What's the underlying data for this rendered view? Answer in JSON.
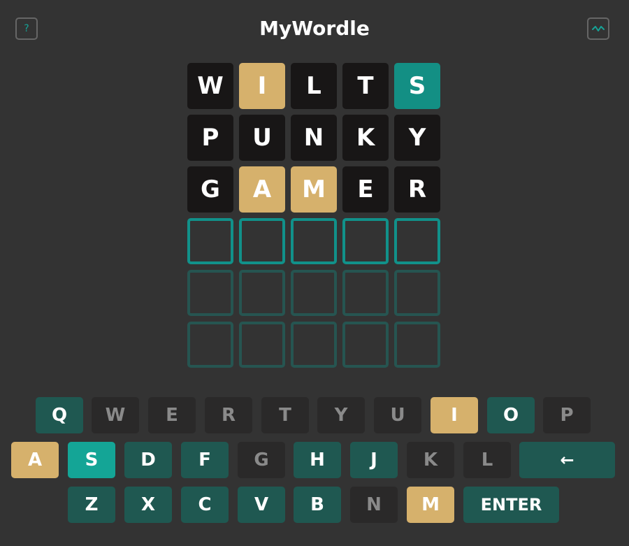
{
  "header": {
    "title": "MyWordle",
    "help_icon": "?",
    "stats_icon": "⌇"
  },
  "board": [
    [
      {
        "letter": "W",
        "state": "absent"
      },
      {
        "letter": "I",
        "state": "present"
      },
      {
        "letter": "L",
        "state": "absent"
      },
      {
        "letter": "T",
        "state": "absent"
      },
      {
        "letter": "S",
        "state": "correct"
      }
    ],
    [
      {
        "letter": "P",
        "state": "absent"
      },
      {
        "letter": "U",
        "state": "absent"
      },
      {
        "letter": "N",
        "state": "absent"
      },
      {
        "letter": "K",
        "state": "absent"
      },
      {
        "letter": "Y",
        "state": "absent"
      }
    ],
    [
      {
        "letter": "G",
        "state": "absent"
      },
      {
        "letter": "A",
        "state": "present"
      },
      {
        "letter": "M",
        "state": "present"
      },
      {
        "letter": "E",
        "state": "absent"
      },
      {
        "letter": "R",
        "state": "absent"
      }
    ],
    [
      {
        "letter": "",
        "state": "empty-active"
      },
      {
        "letter": "",
        "state": "empty-active"
      },
      {
        "letter": "",
        "state": "empty-active"
      },
      {
        "letter": "",
        "state": "empty-active"
      },
      {
        "letter": "",
        "state": "empty-active"
      }
    ],
    [
      {
        "letter": "",
        "state": "empty"
      },
      {
        "letter": "",
        "state": "empty"
      },
      {
        "letter": "",
        "state": "empty"
      },
      {
        "letter": "",
        "state": "empty"
      },
      {
        "letter": "",
        "state": "empty"
      }
    ],
    [
      {
        "letter": "",
        "state": "empty"
      },
      {
        "letter": "",
        "state": "empty"
      },
      {
        "letter": "",
        "state": "empty"
      },
      {
        "letter": "",
        "state": "empty"
      },
      {
        "letter": "",
        "state": "empty"
      }
    ]
  ],
  "keyboard": {
    "row1": [
      {
        "label": "Q",
        "state": "tried"
      },
      {
        "label": "W",
        "state": "unused"
      },
      {
        "label": "E",
        "state": "unused"
      },
      {
        "label": "R",
        "state": "unused"
      },
      {
        "label": "T",
        "state": "unused"
      },
      {
        "label": "Y",
        "state": "unused"
      },
      {
        "label": "U",
        "state": "unused"
      },
      {
        "label": "I",
        "state": "present"
      },
      {
        "label": "O",
        "state": "tried"
      },
      {
        "label": "P",
        "state": "unused"
      }
    ],
    "row2": [
      {
        "label": "A",
        "state": "present"
      },
      {
        "label": "S",
        "state": "correct"
      },
      {
        "label": "D",
        "state": "tried"
      },
      {
        "label": "F",
        "state": "tried"
      },
      {
        "label": "G",
        "state": "unused"
      },
      {
        "label": "H",
        "state": "tried"
      },
      {
        "label": "J",
        "state": "tried"
      },
      {
        "label": "K",
        "state": "unused"
      },
      {
        "label": "L",
        "state": "unused"
      },
      {
        "label": "←",
        "state": "tried",
        "key": "backspace"
      }
    ],
    "row3": [
      {
        "label": "Z",
        "state": "tried"
      },
      {
        "label": "X",
        "state": "tried"
      },
      {
        "label": "C",
        "state": "tried"
      },
      {
        "label": "V",
        "state": "tried"
      },
      {
        "label": "B",
        "state": "tried"
      },
      {
        "label": "N",
        "state": "unused"
      },
      {
        "label": "M",
        "state": "present"
      },
      {
        "label": "ENTER",
        "state": "tried",
        "key": "enter"
      }
    ]
  },
  "colors": {
    "background": "#333333",
    "absent": "#181616",
    "present": "#d6b16c",
    "correct": "#138f84",
    "key_tried": "#1f5851",
    "key_unused": "#2a2929",
    "active_border": "#11918a",
    "empty_border": "#265551"
  }
}
